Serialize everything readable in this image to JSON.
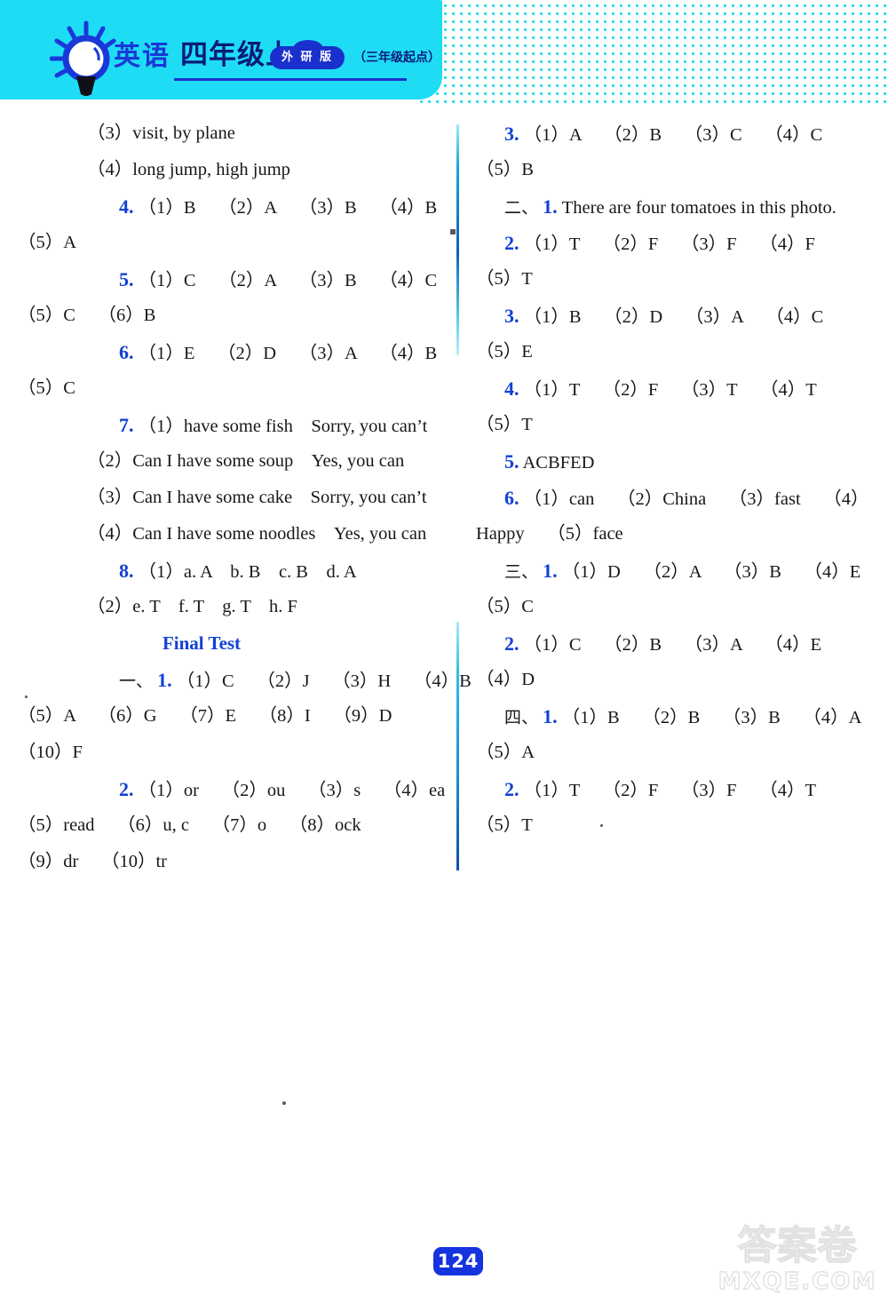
{
  "header": {
    "logo_icon": "lightbulb-icon",
    "subject": "英语",
    "grade": "四年级上",
    "edition_badge": "外 研 版",
    "starting_point": "（三年级起点）"
  },
  "left_column": {
    "lines": [
      {
        "kind": "hang",
        "text": "（3）visit, by plane"
      },
      {
        "kind": "hang",
        "text": "（4）long jump, high jump"
      },
      {
        "kind": "indent",
        "num": "4.",
        "text": "（1）B　 （2）A　 （3）B　 （4）B"
      },
      {
        "kind": "plain",
        "text": "（5）A"
      },
      {
        "kind": "indent",
        "num": "5.",
        "text": "（1）C　 （2）A　 （3）B　 （4）C"
      },
      {
        "kind": "plain",
        "text": "（5）C　 （6）B"
      },
      {
        "kind": "indent",
        "num": "6.",
        "text": "（1）E　 （2）D　 （3）A　 （4）B"
      },
      {
        "kind": "plain",
        "text": "（5）C"
      },
      {
        "kind": "indent",
        "num": "7.",
        "text": "（1）have some fish　Sorry, you can’t"
      },
      {
        "kind": "hang",
        "text": "（2）Can I have some soup　Yes, you can"
      },
      {
        "kind": "hang",
        "text": "（3）Can I have some cake　Sorry, you can’t"
      },
      {
        "kind": "hang",
        "text": "（4）Can I have some noodles　Yes, you can"
      },
      {
        "kind": "indent",
        "num": "8.",
        "text": "（1）a. A　b. B　c. B　d. A"
      },
      {
        "kind": "hang",
        "text": "（2）e. T　f. T　g. T　h. F"
      },
      {
        "kind": "title",
        "text": "Final Test"
      },
      {
        "kind": "indent",
        "cn": "一、",
        "num": "1.",
        "text": "（1）C　 （2）J　 （3）H　 （4）B"
      },
      {
        "kind": "plain",
        "text": "（5）A　 （6）G　 （7）E　 （8）I　 （9）D"
      },
      {
        "kind": "plain",
        "text": "（10）F"
      },
      {
        "kind": "indent",
        "num": "2.",
        "text": "（1）or　 （2）ou　 （3）s　 （4）ea"
      },
      {
        "kind": "plain",
        "text": "（5）read　 （6）u, c　 （7）o　 （8）ock"
      },
      {
        "kind": "plain",
        "text": "（9）dr　 （10）tr"
      }
    ]
  },
  "right_column": {
    "lines": [
      {
        "kind": "indent",
        "num": "3.",
        "text": "（1）A　 （2）B　 （3）C　 （4）C"
      },
      {
        "kind": "plain",
        "text": "（5）B"
      },
      {
        "kind": "indent",
        "cn": "二、",
        "num": "1.",
        "text": "There are four tomatoes in this photo."
      },
      {
        "kind": "indent",
        "num": "2.",
        "text": "（1）T　 （2）F　 （3）F　 （4）F"
      },
      {
        "kind": "plain",
        "text": "（5）T"
      },
      {
        "kind": "indent",
        "num": "3.",
        "text": "（1）B　 （2）D　 （3）A　 （4）C"
      },
      {
        "kind": "plain",
        "text": "（5）E"
      },
      {
        "kind": "indent",
        "num": "4.",
        "text": "（1）T　 （2）F　 （3）T　 （4）T"
      },
      {
        "kind": "plain",
        "text": "（5）T"
      },
      {
        "kind": "indent",
        "num": "5.",
        "text": "ACBFED"
      },
      {
        "kind": "indent",
        "num": "6.",
        "text": "（1）can　 （2）China　 （3）fast　 （4）"
      },
      {
        "kind": "plain",
        "text": "Happy　 （5）face"
      },
      {
        "kind": "indent",
        "cn": "三、",
        "num": "1.",
        "text": "（1）D　 （2）A　 （3）B　 （4）E"
      },
      {
        "kind": "plain",
        "text": "（5）C"
      },
      {
        "kind": "indent",
        "num": "2.",
        "text": "（1）C　 （2）B　 （3）A　 （4）E"
      },
      {
        "kind": "plain",
        "text": "（4）D"
      },
      {
        "kind": "indent",
        "cn": "四、",
        "num": "1.",
        "text": "（1）B　 （2）B　 （3）B　 （4）A"
      },
      {
        "kind": "plain",
        "text": "（5）A"
      },
      {
        "kind": "indent",
        "num": "2.",
        "text": "（1）T　 （2）F　 （3）F　 （4）T"
      },
      {
        "kind": "plain",
        "text": "（5）T"
      }
    ]
  },
  "footer": {
    "page_number": "124",
    "watermark_cn": "答案卷",
    "watermark_url": "MXQE.COM"
  },
  "colors": {
    "banner_cyan": "#1fdcf5",
    "heading_blue": "#1341d6",
    "ink_black": "#16171c",
    "badge_blue": "#1633e0"
  }
}
